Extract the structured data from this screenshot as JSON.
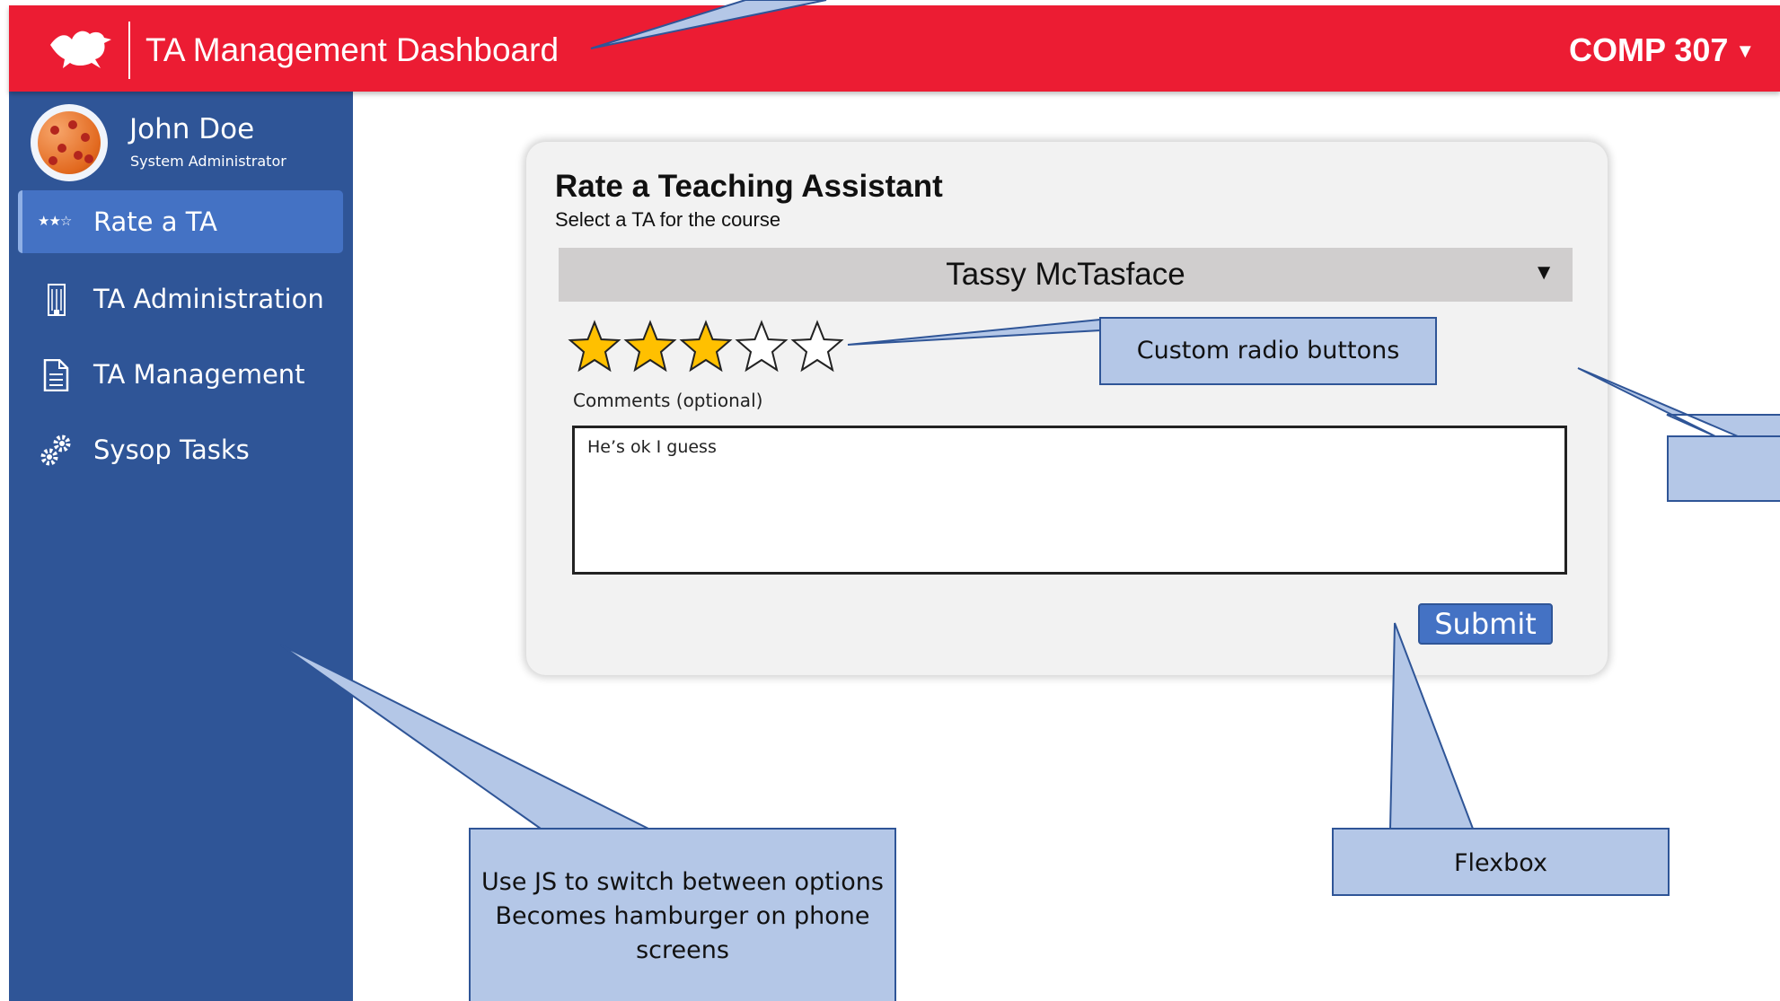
{
  "header": {
    "title": "TA Management Dashboard",
    "course": "COMP 307",
    "course_caret": "▼",
    "logo_icon": "bird-logo-icon",
    "colors": {
      "bar": "#ec1c33",
      "text": "#ffffff"
    }
  },
  "user": {
    "name": "John Doe",
    "role": "System Administrator",
    "avatar_icon": "pizza-avatar-icon"
  },
  "sidebar": {
    "items": [
      {
        "label": "Rate a TA",
        "icon": "three-stars-icon",
        "icon_glyph": "★★☆",
        "active": true
      },
      {
        "label": "TA Administration",
        "icon": "building-icon",
        "active": false
      },
      {
        "label": "TA Management",
        "icon": "document-icon",
        "active": false
      },
      {
        "label": "Sysop Tasks",
        "icon": "gears-icon",
        "active": false
      }
    ],
    "colors": {
      "background": "#2f5597",
      "active": "#4472c4"
    }
  },
  "card": {
    "title": "Rate a Teaching Assistant",
    "subtitle": "Select a TA for the course",
    "selected_ta": "Tassy McTasface",
    "select_caret": "▼",
    "rating": 3,
    "rating_max": 5,
    "comments_label": "Comments (optional)",
    "comments_value": "He’s ok I guess",
    "submit_label": "Submit",
    "colors": {
      "star_fill": "#ffc000",
      "submit": "#4472c4"
    }
  },
  "callouts": {
    "radio": "Custom radio buttons",
    "sidebar_note": "Use JS to switch between options Becomes hamburger on phone screens",
    "flexbox": "Flexbox",
    "color": "#b4c7e7"
  }
}
